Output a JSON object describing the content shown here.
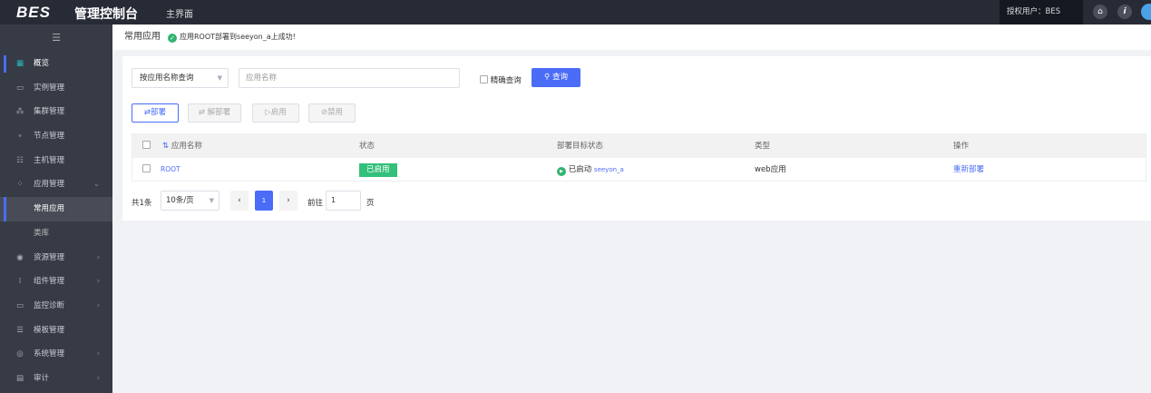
{
  "header": {
    "logo": "BES",
    "title": "管理控制台",
    "home": "主界面",
    "license": "授权用户：BES TRIAL",
    "icons": [
      "home-icon",
      "info-icon",
      "avatar"
    ]
  },
  "sidebar": {
    "toggle_icon": "menu-icon",
    "items": [
      {
        "label": "概览",
        "icon": "dashboard-icon",
        "active": true
      },
      {
        "label": "实例管理",
        "icon": "instance-icon"
      },
      {
        "label": "集群管理",
        "icon": "cluster-icon"
      },
      {
        "label": "节点管理",
        "icon": "node-icon"
      },
      {
        "label": "主机管理",
        "icon": "host-icon"
      },
      {
        "label": "应用管理",
        "icon": "app-icon",
        "expanded": true,
        "children": [
          {
            "label": "常用应用",
            "active": true
          },
          {
            "label": "类库"
          }
        ]
      },
      {
        "label": "资源管理",
        "icon": "resource-icon",
        "arrow": true
      },
      {
        "label": "组件管理",
        "icon": "component-icon",
        "arrow": true
      },
      {
        "label": "监控诊断",
        "icon": "monitor-icon",
        "arrow": true
      },
      {
        "label": "模板管理",
        "icon": "template-icon"
      },
      {
        "label": "系统管理",
        "icon": "settings-icon",
        "arrow": true
      },
      {
        "label": "审计",
        "icon": "audit-icon",
        "arrow": true
      }
    ]
  },
  "breadcrumb": {
    "title": "常用应用",
    "message": "应用ROOT部署到seeyon_a上成功!"
  },
  "search": {
    "mode": "按应用名称查询",
    "placeholder": "应用名称",
    "exact_label": "精确查询",
    "query_label": "查询"
  },
  "actions": {
    "deploy": "部署",
    "undeploy": "解部署",
    "enable": "启用",
    "disable": "禁用"
  },
  "table": {
    "columns": [
      "应用名称",
      "状态",
      "部署目标状态",
      "类型",
      "操作"
    ],
    "rows": [
      {
        "name": "ROOT",
        "status": "已启用",
        "target_state": "已启动",
        "target": "seeyon_a",
        "type": "web应用",
        "action": "重新部署"
      }
    ]
  },
  "pagination": {
    "total": "共1条",
    "page_size": "10条/页",
    "current": "1",
    "goto_label": "前往",
    "goto_value": "1",
    "page_suffix": "页"
  },
  "colors": {
    "primary": "#4a6cf7",
    "success": "#33c07a",
    "sidebar": "#363b46",
    "header": "#262b36"
  }
}
